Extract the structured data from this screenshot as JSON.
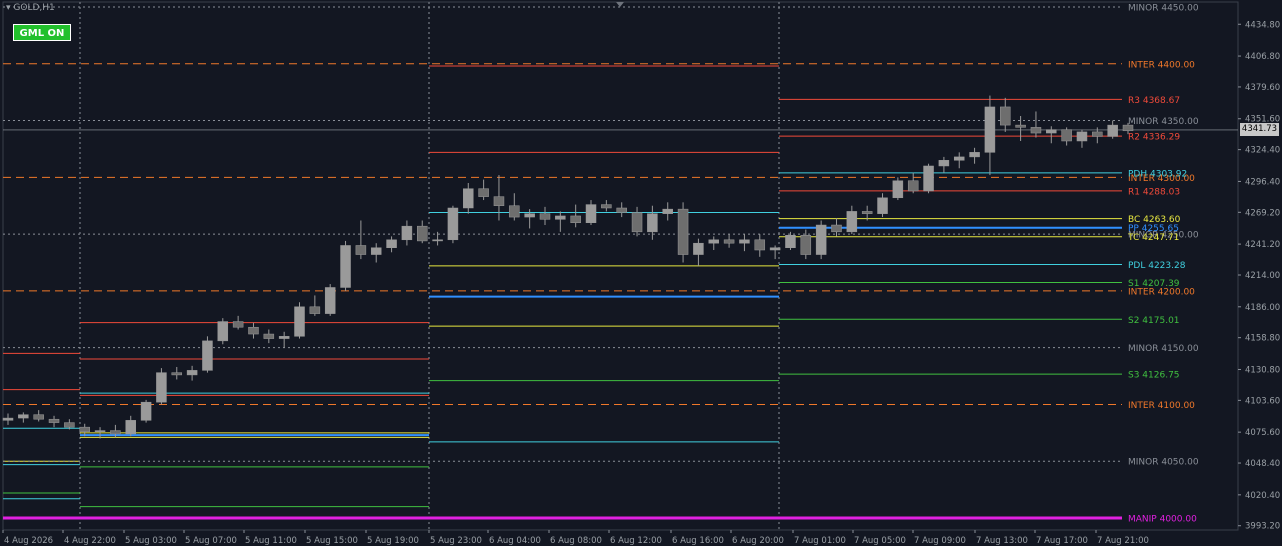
{
  "header": {
    "symbol": "GOLD,H1",
    "menu_icon": "dropdown-triangle-icon"
  },
  "indicator_button": {
    "label": "GML ON",
    "color": "#22c02c"
  },
  "price_axis": {
    "current_price": "4341.73",
    "ticks": [
      "4434.80",
      "4406.80",
      "4379.60",
      "4351.60",
      "4324.40",
      "4296.40",
      "4269.20",
      "4241.20",
      "4214.00",
      "4186.00",
      "4158.80",
      "4130.80",
      "4103.60",
      "4075.60",
      "4048.40",
      "4020.40",
      "3993.20"
    ]
  },
  "time_axis": {
    "labels": [
      "4 Aug 2026",
      "4 Aug 22:00",
      "5 Aug 03:00",
      "5 Aug 07:00",
      "5 Aug 11:00",
      "5 Aug 15:00",
      "5 Aug 19:00",
      "5 Aug 23:00",
      "6 Aug 04:00",
      "6 Aug 08:00",
      "6 Aug 12:00",
      "6 Aug 16:00",
      "6 Aug 20:00",
      "7 Aug 01:00",
      "7 Aug 05:00",
      "7 Aug 09:00",
      "7 Aug 13:00",
      "7 Aug 17:00",
      "7 Aug 21:00"
    ]
  },
  "levels": [
    {
      "label": "MINOR 4450.00",
      "price": 4450,
      "color": "#8a8f98",
      "style": "minor"
    },
    {
      "label": "INTER 4400.00",
      "price": 4400,
      "color": "#f0782a",
      "style": "inter"
    },
    {
      "label": "MINOR 4350.00",
      "price": 4350,
      "color": "#8a8f98",
      "style": "minor"
    },
    {
      "label": "INTER 4300.00",
      "price": 4300,
      "color": "#f0782a",
      "style": "inter"
    },
    {
      "label": "MINOR 4250.00",
      "price": 4250,
      "color": "#8a8f98",
      "style": "minor"
    },
    {
      "label": "INTER 4200.00",
      "price": 4200,
      "color": "#f0782a",
      "style": "inter"
    },
    {
      "label": "MINOR 4150.00",
      "price": 4150,
      "color": "#8a8f98",
      "style": "minor"
    },
    {
      "label": "INTER 4100.00",
      "price": 4100,
      "color": "#f0782a",
      "style": "inter"
    },
    {
      "label": "MINOR 4050.00",
      "price": 4050,
      "color": "#8a8f98",
      "style": "minor"
    },
    {
      "label": "MANIP 4000.00",
      "price": 4000,
      "color": "#e020e0",
      "style": "manip"
    }
  ],
  "pivots": [
    {
      "label": "R3  4368.67",
      "price": 4368.67,
      "color": "#f04a3a"
    },
    {
      "label": "R2  4336.29",
      "price": 4336.29,
      "color": "#f04a3a"
    },
    {
      "label": "PDH  4303.92",
      "price": 4303.92,
      "color": "#40d0e0"
    },
    {
      "label": "R1  4288.03",
      "price": 4288.03,
      "color": "#f04a3a"
    },
    {
      "label": "BC  4263.60",
      "price": 4263.6,
      "color": "#e8e840"
    },
    {
      "label": "PP  4255.65",
      "price": 4255.65,
      "color": "#3090ff"
    },
    {
      "label": "TC  4247.71",
      "price": 4247.71,
      "color": "#e8e840"
    },
    {
      "label": "PDL  4223.28",
      "price": 4223.28,
      "color": "#40d0e0"
    },
    {
      "label": "S1  4207.39",
      "price": 4207.39,
      "color": "#40c040"
    },
    {
      "label": "S2  4175.01",
      "price": 4175.01,
      "color": "#40c040"
    },
    {
      "label": "S3  4126.75",
      "price": 4126.75,
      "color": "#40c040"
    }
  ],
  "chart_data": {
    "type": "candlestick",
    "symbol": "GOLD,H1",
    "ylim": [
      3987,
      4455
    ],
    "bull_color": "#9a9a9a",
    "bear_color": "#9a9a9a",
    "candles": [
      [
        4086,
        4092,
        4082,
        4088
      ],
      [
        4088,
        4093,
        4084,
        4091
      ],
      [
        4091,
        4095,
        4085,
        4087
      ],
      [
        4087,
        4090,
        4080,
        4084
      ],
      [
        4084,
        4087,
        4078,
        4080
      ],
      [
        4080,
        4083,
        4072,
        4076
      ],
      [
        4076,
        4080,
        4070,
        4077
      ],
      [
        4077,
        4082,
        4071,
        4074
      ],
      [
        4074,
        4090,
        4072,
        4086
      ],
      [
        4086,
        4104,
        4084,
        4102
      ],
      [
        4102,
        4132,
        4100,
        4128
      ],
      [
        4128,
        4133,
        4122,
        4126
      ],
      [
        4126,
        4134,
        4121,
        4130
      ],
      [
        4130,
        4160,
        4128,
        4156
      ],
      [
        4156,
        4176,
        4153,
        4173
      ],
      [
        4173,
        4178,
        4166,
        4168
      ],
      [
        4168,
        4172,
        4158,
        4162
      ],
      [
        4162,
        4166,
        4154,
        4158
      ],
      [
        4158,
        4164,
        4150,
        4160
      ],
      [
        4160,
        4190,
        4158,
        4186
      ],
      [
        4186,
        4196,
        4178,
        4180
      ],
      [
        4180,
        4206,
        4178,
        4203
      ],
      [
        4203,
        4244,
        4200,
        4240
      ],
      [
        4240,
        4262,
        4228,
        4232
      ],
      [
        4232,
        4242,
        4225,
        4238
      ],
      [
        4238,
        4248,
        4234,
        4245
      ],
      [
        4245,
        4262,
        4240,
        4257
      ],
      [
        4257,
        4262,
        4242,
        4244
      ],
      [
        4244,
        4252,
        4240,
        4245
      ],
      [
        4245,
        4275,
        4242,
        4273
      ],
      [
        4273,
        4295,
        4268,
        4290
      ],
      [
        4290,
        4298,
        4280,
        4283
      ],
      [
        4283,
        4302,
        4262,
        4275
      ],
      [
        4275,
        4286,
        4262,
        4265
      ],
      [
        4265,
        4272,
        4255,
        4268
      ],
      [
        4268,
        4274,
        4258,
        4263
      ],
      [
        4263,
        4270,
        4252,
        4266
      ],
      [
        4266,
        4276,
        4256,
        4260
      ],
      [
        4260,
        4280,
        4258,
        4276
      ],
      [
        4276,
        4280,
        4270,
        4273
      ],
      [
        4273,
        4278,
        4265,
        4269
      ],
      [
        4269,
        4274,
        4248,
        4252
      ],
      [
        4252,
        4275,
        4245,
        4268
      ],
      [
        4268,
        4278,
        4262,
        4272
      ],
      [
        4272,
        4278,
        4225,
        4232
      ],
      [
        4232,
        4246,
        4222,
        4242
      ],
      [
        4242,
        4248,
        4236,
        4245
      ],
      [
        4245,
        4250,
        4238,
        4242
      ],
      [
        4242,
        4250,
        4235,
        4245
      ],
      [
        4245,
        4250,
        4230,
        4236
      ],
      [
        4236,
        4240,
        4228,
        4238
      ],
      [
        4238,
        4252,
        4236,
        4249
      ],
      [
        4249,
        4254,
        4228,
        4232
      ],
      [
        4232,
        4262,
        4228,
        4258
      ],
      [
        4258,
        4264,
        4248,
        4252
      ],
      [
        4252,
        4275,
        4250,
        4270
      ],
      [
        4270,
        4275,
        4262,
        4268
      ],
      [
        4268,
        4286,
        4265,
        4282
      ],
      [
        4282,
        4300,
        4280,
        4297
      ],
      [
        4297,
        4304,
        4286,
        4288
      ],
      [
        4288,
        4312,
        4286,
        4310
      ],
      [
        4310,
        4318,
        4304,
        4315
      ],
      [
        4315,
        4322,
        4308,
        4318
      ],
      [
        4318,
        4326,
        4312,
        4322
      ],
      [
        4322,
        4372,
        4302,
        4362
      ],
      [
        4362,
        4370,
        4340,
        4346
      ],
      [
        4346,
        4354,
        4332,
        4344
      ],
      [
        4344,
        4358,
        4335,
        4339
      ],
      [
        4339,
        4345,
        4330,
        4342
      ],
      [
        4342,
        4344,
        4328,
        4332
      ],
      [
        4332,
        4342,
        4326,
        4340
      ],
      [
        4340,
        4344,
        4330,
        4336
      ],
      [
        4336,
        4350,
        4334,
        4346
      ],
      [
        4346,
        4348,
        4338,
        4341
      ]
    ]
  }
}
